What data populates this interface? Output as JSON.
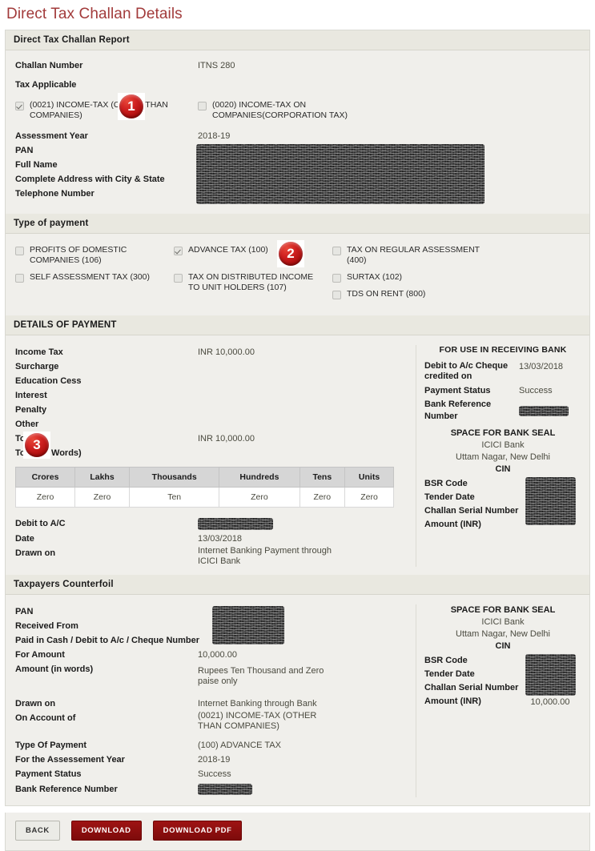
{
  "page": {
    "title": "Direct Tax Challan Details",
    "title_color": "#A23B3B"
  },
  "challan_report": {
    "heading": "Direct Tax Challan Report",
    "challan_number_label": "Challan Number",
    "challan_number_value": "ITNS 280",
    "tax_applicable_label": "Tax Applicable",
    "tax_applicable_options": [
      {
        "label": "(0021) INCOME-TAX (OTHER THAN COMPANIES)",
        "checked": true
      },
      {
        "label": "(0020) INCOME-TAX ON COMPANIES(CORPORATION TAX)",
        "checked": false
      }
    ],
    "fields": [
      {
        "label": "Assessment Year",
        "value": "2018-19"
      },
      {
        "label": "PAN",
        "value": ""
      },
      {
        "label": "Full Name",
        "value": ""
      },
      {
        "label": "Complete Address with City & State",
        "value": ""
      },
      {
        "label": "Telephone Number",
        "value": ""
      }
    ]
  },
  "type_of_payment": {
    "heading": "Type of payment",
    "options": [
      {
        "label": "PROFITS OF DOMESTIC COMPANIES (106)",
        "checked": false
      },
      {
        "label": "ADVANCE TAX (100)",
        "checked": true
      },
      {
        "label": "TAX ON REGULAR ASSESSMENT (400)",
        "checked": false
      },
      {
        "label": "SELF ASSESSMENT TAX (300)",
        "checked": false
      },
      {
        "label": "TAX ON DISTRIBUTED INCOME TO UNIT HOLDERS (107)",
        "checked": false
      },
      {
        "label": "SURTAX (102)",
        "checked": false
      },
      {
        "label": "TDS ON RENT (800)",
        "checked": false
      }
    ]
  },
  "details_of_payment": {
    "heading": "DETAILS OF PAYMENT",
    "rows": [
      {
        "label": "Income Tax",
        "value": "INR 10,000.00"
      },
      {
        "label": "Surcharge",
        "value": ""
      },
      {
        "label": "Education Cess",
        "value": ""
      },
      {
        "label": "Interest",
        "value": ""
      },
      {
        "label": "Penalty",
        "value": ""
      },
      {
        "label": "Other",
        "value": ""
      },
      {
        "label": "Total",
        "value": "INR 10,000.00"
      },
      {
        "label": "Total (In Words)",
        "value": ""
      }
    ],
    "denomination_table": {
      "headers": [
        "Crores",
        "Lakhs",
        "Thousands",
        "Hundreds",
        "Tens",
        "Units"
      ],
      "values": [
        "Zero",
        "Zero",
        "Ten",
        "Zero",
        "Zero",
        "Zero"
      ]
    },
    "footer_rows": [
      {
        "label": "Debit to A/C",
        "value": "",
        "redacted": true
      },
      {
        "label": "Date",
        "value": "13/03/2018",
        "redacted": false
      },
      {
        "label": "Drawn on",
        "value": "Internet Banking Payment through ICICI Bank",
        "redacted": false
      }
    ],
    "receiving_bank": {
      "panel_title": "FOR USE IN RECEIVING BANK",
      "rows": [
        {
          "label": "Debit to A/c Cheque credited on",
          "value": "13/03/2018"
        },
        {
          "label": "Payment Status",
          "value": "Success"
        },
        {
          "label": "Bank Reference Number",
          "value": "",
          "redacted": true
        }
      ],
      "seal_title": "SPACE FOR BANK SEAL",
      "bank_name": "ICICI Bank",
      "bank_branch": "Uttam Nagar, New Delhi",
      "cin_label": "CIN",
      "cin_rows": [
        {
          "label": "BSR Code",
          "value": ""
        },
        {
          "label": "Tender Date",
          "value": ""
        },
        {
          "label": "Challan Serial Number",
          "value": ""
        },
        {
          "label": "Amount (INR)",
          "value": ""
        }
      ]
    }
  },
  "counterfoil": {
    "heading": "Taxpayers Counterfoil",
    "rows": [
      {
        "label": "PAN",
        "value": "",
        "redacted": true
      },
      {
        "label": "Received From",
        "value": ""
      },
      {
        "label": "Paid in Cash / Debit to A/c / Cheque Number",
        "value": ""
      },
      {
        "label": "For Amount",
        "value": "10,000.00"
      },
      {
        "label": "Amount (in words)",
        "value": "Rupees Ten Thousand and Zero paise only"
      },
      {
        "label": "Drawn on",
        "value": "Internet Banking through Bank"
      },
      {
        "label": "On Account of",
        "value": "(0021) INCOME-TAX (OTHER THAN COMPANIES)"
      },
      {
        "label": "Type Of Payment",
        "value": "(100) ADVANCE TAX"
      },
      {
        "label": "For the Assessement Year",
        "value": "2018-19"
      },
      {
        "label": "Payment Status",
        "value": "Success"
      },
      {
        "label": "Bank Reference Number",
        "value": "",
        "redacted": true
      }
    ],
    "seal": {
      "seal_title": "SPACE FOR BANK SEAL",
      "bank_name": "ICICI Bank",
      "bank_branch": "Uttam Nagar, New Delhi",
      "cin_label": "CIN",
      "cin_rows": [
        {
          "label": "BSR Code",
          "value": ""
        },
        {
          "label": "Tender Date",
          "value": ""
        },
        {
          "label": "Challan Serial Number",
          "value": ""
        },
        {
          "label": "Amount (INR)",
          "value": "10,000.00"
        }
      ]
    }
  },
  "buttons": {
    "back": "BACK",
    "download": "DOWNLOAD",
    "download_pdf": "DOWNLOAD PDF"
  },
  "annotations": [
    {
      "number": "1"
    },
    {
      "number": "2"
    },
    {
      "number": "3"
    }
  ]
}
